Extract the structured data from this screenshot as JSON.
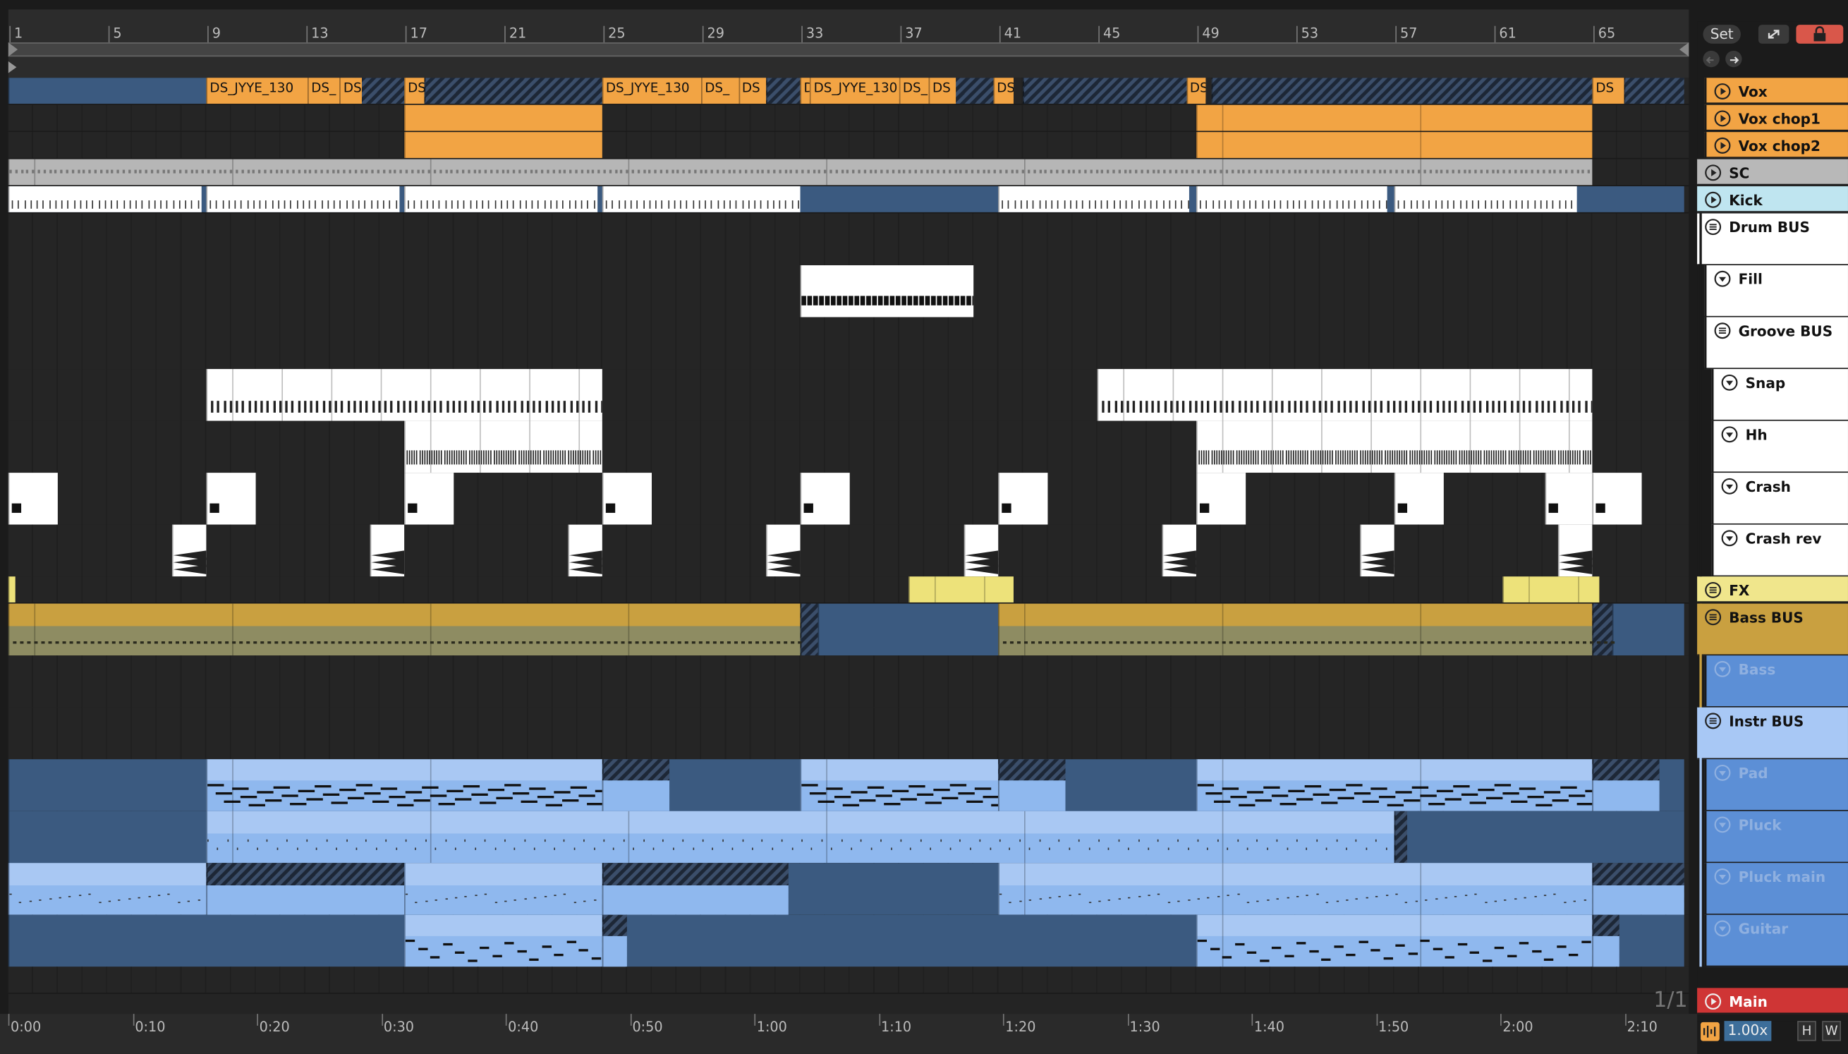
{
  "ruler": {
    "bars": [
      "1",
      "5",
      "9",
      "13",
      "17",
      "21",
      "25",
      "29",
      "33",
      "37",
      "41",
      "45",
      "49",
      "53",
      "57",
      "61",
      "65"
    ]
  },
  "header_bar": {
    "set_label": "Set"
  },
  "timeline": {
    "labels": [
      "0:00",
      "0:10",
      "0:20",
      "0:30",
      "0:40",
      "0:50",
      "1:00",
      "1:10",
      "1:20",
      "1:30",
      "1:40",
      "1:50",
      "2:00",
      "2:10"
    ]
  },
  "zoom": "1.00x",
  "page_indicator": "1/1",
  "buttons": {
    "h": "H",
    "w": "W"
  },
  "clip_names": [
    "DS_JYYE_130",
    "DS_",
    "DS"
  ],
  "tracks": [
    {
      "name": "Vox",
      "color": "#f2a444",
      "icon": "play-icon"
    },
    {
      "name": "Vox chop1",
      "color": "#f2a444",
      "icon": "play-icon"
    },
    {
      "name": "Vox chop2",
      "color": "#f2a444",
      "icon": "play-icon"
    },
    {
      "name": "SC",
      "color": "#b8b8b8",
      "icon": "play-icon"
    },
    {
      "name": "Kick",
      "color": "#bfe5f0",
      "icon": "play-icon"
    },
    {
      "name": "Drum BUS",
      "color": "#ffffff",
      "icon": "group-icon"
    },
    {
      "name": "Fill",
      "color": "#ffffff",
      "icon": "fold-icon"
    },
    {
      "name": "Groove BUS",
      "color": "#ffffff",
      "icon": "group-icon"
    },
    {
      "name": "Snap",
      "color": "#ffffff",
      "icon": "fold-icon"
    },
    {
      "name": "Hh",
      "color": "#ffffff",
      "icon": "fold-icon"
    },
    {
      "name": "Crash",
      "color": "#ffffff",
      "icon": "fold-icon"
    },
    {
      "name": "Crash rev",
      "color": "#ffffff",
      "icon": "fold-icon"
    },
    {
      "name": "FX",
      "color": "#f0e68c",
      "icon": "group-icon"
    },
    {
      "name": "Bass BUS",
      "color": "#c9a040",
      "icon": "group-icon"
    },
    {
      "name": "Bass",
      "color": "#5c8fd6",
      "icon": "fold-icon"
    },
    {
      "name": "Instr BUS",
      "color": "#a8c8f5",
      "icon": "group-icon"
    },
    {
      "name": "Pad",
      "color": "#5c8fd6",
      "icon": "fold-icon"
    },
    {
      "name": "Pluck",
      "color": "#5c8fd6",
      "icon": "fold-icon"
    },
    {
      "name": "Pluck main",
      "color": "#5c8fd6",
      "icon": "fold-icon"
    },
    {
      "name": "Guitar",
      "color": "#5c8fd6",
      "icon": "fold-icon"
    },
    {
      "name": "Main",
      "color": "#cf3535",
      "icon": "play-icon"
    }
  ]
}
